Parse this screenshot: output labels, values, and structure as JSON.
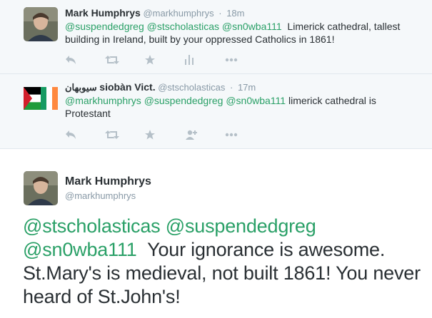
{
  "replies": [
    {
      "name": "Mark Humphrys",
      "handle": "@markhumphrys",
      "time": "18m",
      "mentions": [
        "@suspendedgreg",
        "@stscholasticas",
        "@sn0wba111"
      ],
      "text": "Limerick cathedral, tallest building in Ireland, built by your oppressed Catholics in 1861!",
      "actions": [
        "reply-icon",
        "retweet-icon",
        "favorite-icon",
        "stats-icon",
        "more-icon"
      ]
    },
    {
      "name_rtl": "سيوبهان",
      "name": "siobàn Vict.",
      "handle": "@stscholasticas",
      "time": "17m",
      "mentions": [
        "@markhumphrys",
        "@suspendedgreg",
        "@sn0wba111"
      ],
      "text": "limerick cathedral is Protestant",
      "actions": [
        "reply-icon",
        "retweet-icon",
        "favorite-icon",
        "follow-icon",
        "more-icon"
      ]
    }
  ],
  "main_tweet": {
    "name": "Mark Humphrys",
    "handle": "@markhumphrys",
    "mentions": [
      "@stscholasticas",
      "@suspendedgreg",
      "@sn0wba111"
    ],
    "text": "Your ignorance is awesome. St.Mary's is medieval, not built 1861! You never heard of St.John's!"
  },
  "colors": {
    "mention": "#2aa067",
    "muted": "#8899a6",
    "background_replies": "#f5f8fa"
  }
}
